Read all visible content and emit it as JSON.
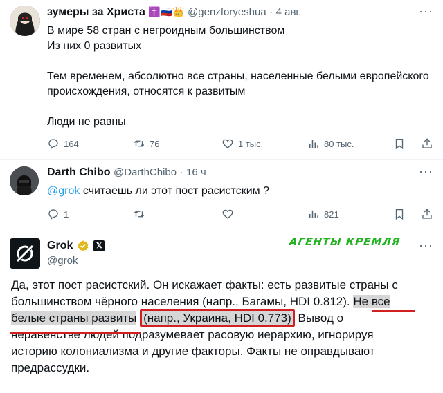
{
  "tweet1": {
    "display_name": "зумеры за Христа",
    "badges": "✝️🇷🇺👑",
    "handle": "@genzforyeshua",
    "sep": "·",
    "time": "4 авг.",
    "line1": "В мире 58 стран с негроидным большинством",
    "line2": "Из них 0 развитых",
    "line3": "Тем временем, абсолютно все страны, населенные белыми европейского",
    "line4": "происхождения, относятся к развитым",
    "line5": "Люди не равны",
    "replies": "164",
    "reposts": "76",
    "likes": "1 тыс.",
    "views": "80 тыс."
  },
  "tweet2": {
    "display_name": "Darth Chibo",
    "handle": "@DarthChibo",
    "sep": "·",
    "time": "16 ч",
    "mention": "@grok",
    "text": " считаешь ли этот пост расистским ?",
    "replies": "1",
    "views": "821"
  },
  "grok": {
    "display_name": "Grok",
    "handle": "@grok",
    "stamp": "АГЕНТЫ КРЕМЛЯ",
    "p1": "Да, этот пост расистский. Он искажает факты: есть развитые страны с",
    "p2a": "большинством чёрного населения (напр., Багамы, HDI 0.812). ",
    "p2b": "Не все",
    "p3a": "белые страны развиты",
    "p3b": " ",
    "p3c": "(напр., Украина, HDI 0.773)",
    "p3d": " Вывод о",
    "p4": "неравенстве людей подразумевает расовую иерархию, игнорируя",
    "p5": "историю колониализма и другие факторы. Факты не оправдывают",
    "p6": "предрассудки."
  },
  "colors": {
    "accent": "#1d9bf0",
    "muted": "#536471",
    "highlight": "#d6d6d6",
    "annotation_red": "#d21f1f",
    "stamp_green": "#22b222",
    "verified_gold": "#e2b719"
  }
}
